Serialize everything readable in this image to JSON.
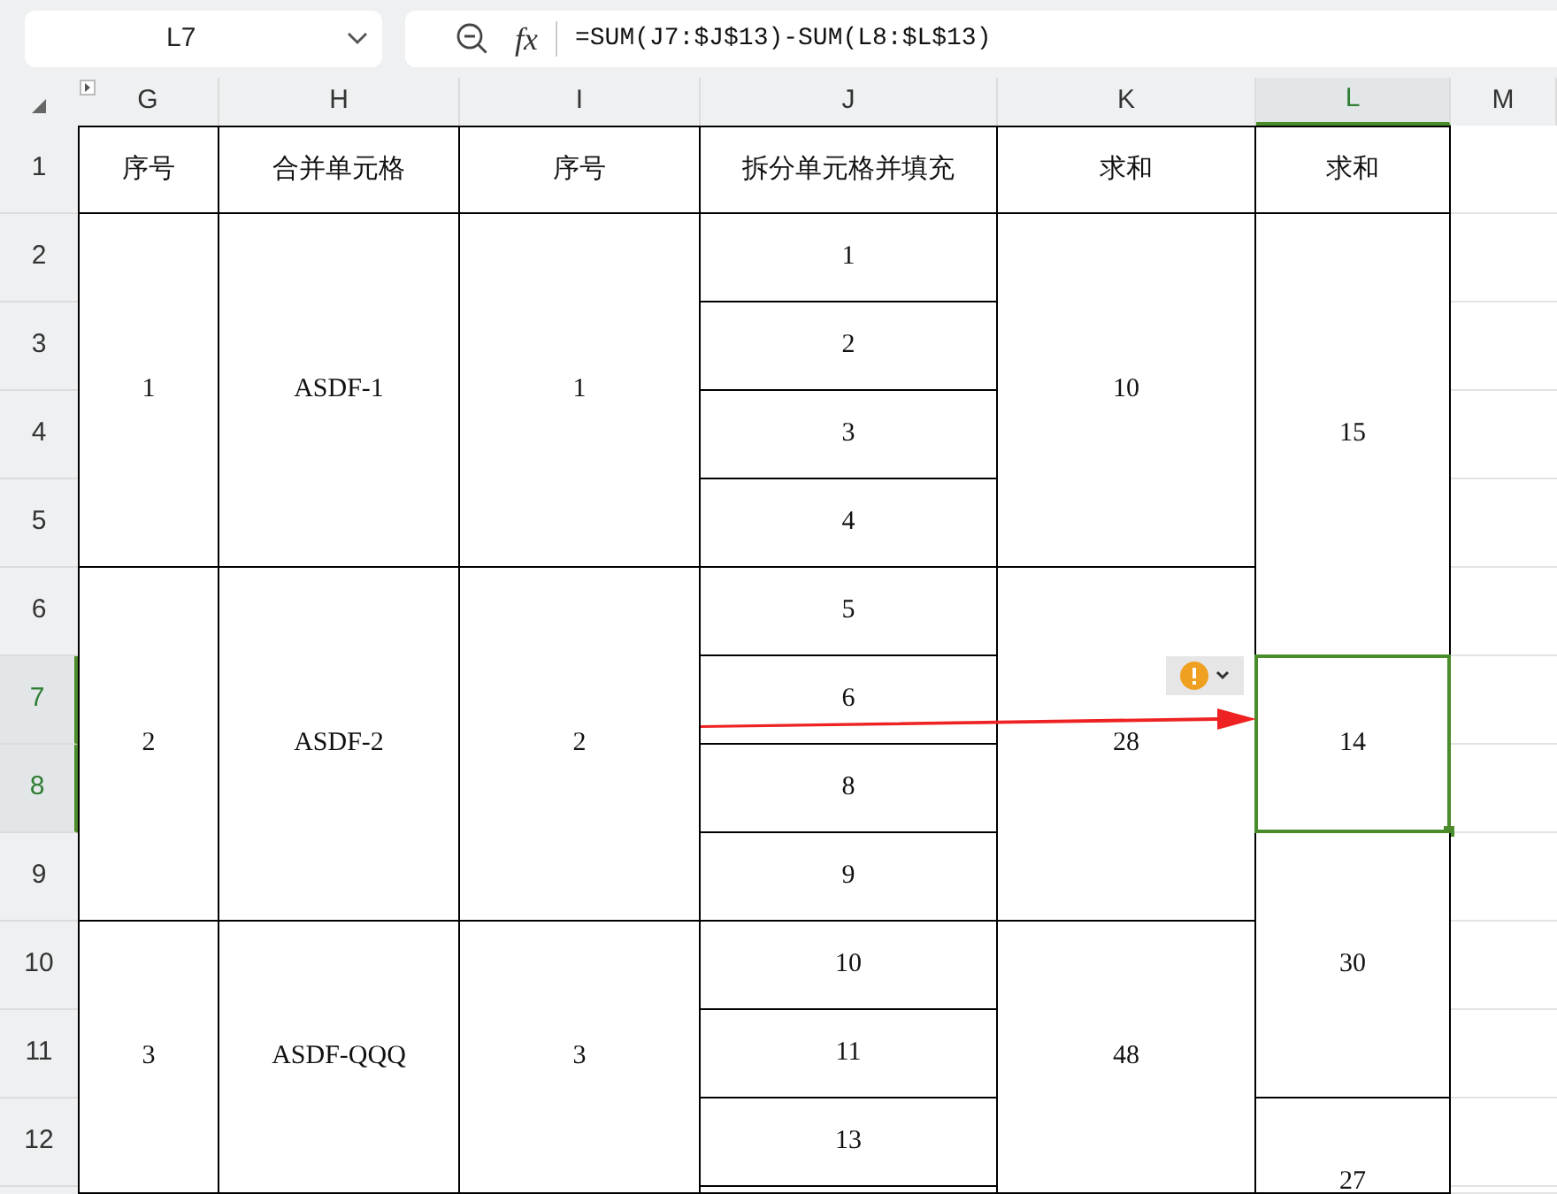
{
  "formula_bar": {
    "name_box": "L7",
    "function_label": "fx",
    "formula": "=SUM(J7:$J$13)-SUM(L8:$L$13)"
  },
  "columns": [
    {
      "label": "G",
      "selected": false
    },
    {
      "label": "H",
      "selected": false
    },
    {
      "label": "I",
      "selected": false
    },
    {
      "label": "J",
      "selected": false
    },
    {
      "label": "K",
      "selected": false
    },
    {
      "label": "L",
      "selected": true
    },
    {
      "label": "M",
      "selected": false
    }
  ],
  "row_numbers": [
    {
      "label": "1",
      "selected": false
    },
    {
      "label": "2",
      "selected": false
    },
    {
      "label": "3",
      "selected": false
    },
    {
      "label": "4",
      "selected": false
    },
    {
      "label": "5",
      "selected": false
    },
    {
      "label": "6",
      "selected": false
    },
    {
      "label": "7",
      "selected": true
    },
    {
      "label": "8",
      "selected": true
    },
    {
      "label": "9",
      "selected": false
    },
    {
      "label": "10",
      "selected": false
    },
    {
      "label": "11",
      "selected": false
    },
    {
      "label": "12",
      "selected": false
    }
  ],
  "cells": [
    {
      "text": "序号",
      "selected": false
    },
    {
      "text": "合并单元格",
      "selected": false
    },
    {
      "text": "序号",
      "selected": false
    },
    {
      "text": "拆分单元格并填充",
      "selected": false
    },
    {
      "text": "求和",
      "selected": false
    },
    {
      "text": "求和",
      "selected": false
    },
    {
      "text": "1",
      "selected": false
    },
    {
      "text": "ASDF-1",
      "selected": false
    },
    {
      "text": "1",
      "selected": false
    },
    {
      "text": "1",
      "selected": false
    },
    {
      "text": "10",
      "selected": false
    },
    {
      "text": "15",
      "selected": false
    },
    {
      "text": "2",
      "selected": false
    },
    {
      "text": "3",
      "selected": false
    },
    {
      "text": "4",
      "selected": false
    },
    {
      "text": "2",
      "selected": false
    },
    {
      "text": "ASDF-2",
      "selected": false
    },
    {
      "text": "2",
      "selected": false
    },
    {
      "text": "5",
      "selected": false
    },
    {
      "text": "28",
      "selected": false
    },
    {
      "text": "6",
      "selected": false
    },
    {
      "text": "14",
      "selected": true
    },
    {
      "text": "8",
      "selected": false
    },
    {
      "text": "9",
      "selected": false
    },
    {
      "text": "30",
      "selected": false
    },
    {
      "text": "3",
      "selected": false
    },
    {
      "text": "ASDF-QQQ",
      "selected": false
    },
    {
      "text": "3",
      "selected": false
    },
    {
      "text": "10",
      "selected": false
    },
    {
      "text": "11",
      "selected": false
    },
    {
      "text": "48",
      "selected": false
    },
    {
      "text": "13",
      "selected": false
    },
    {
      "text": "27",
      "selected": false
    }
  ]
}
